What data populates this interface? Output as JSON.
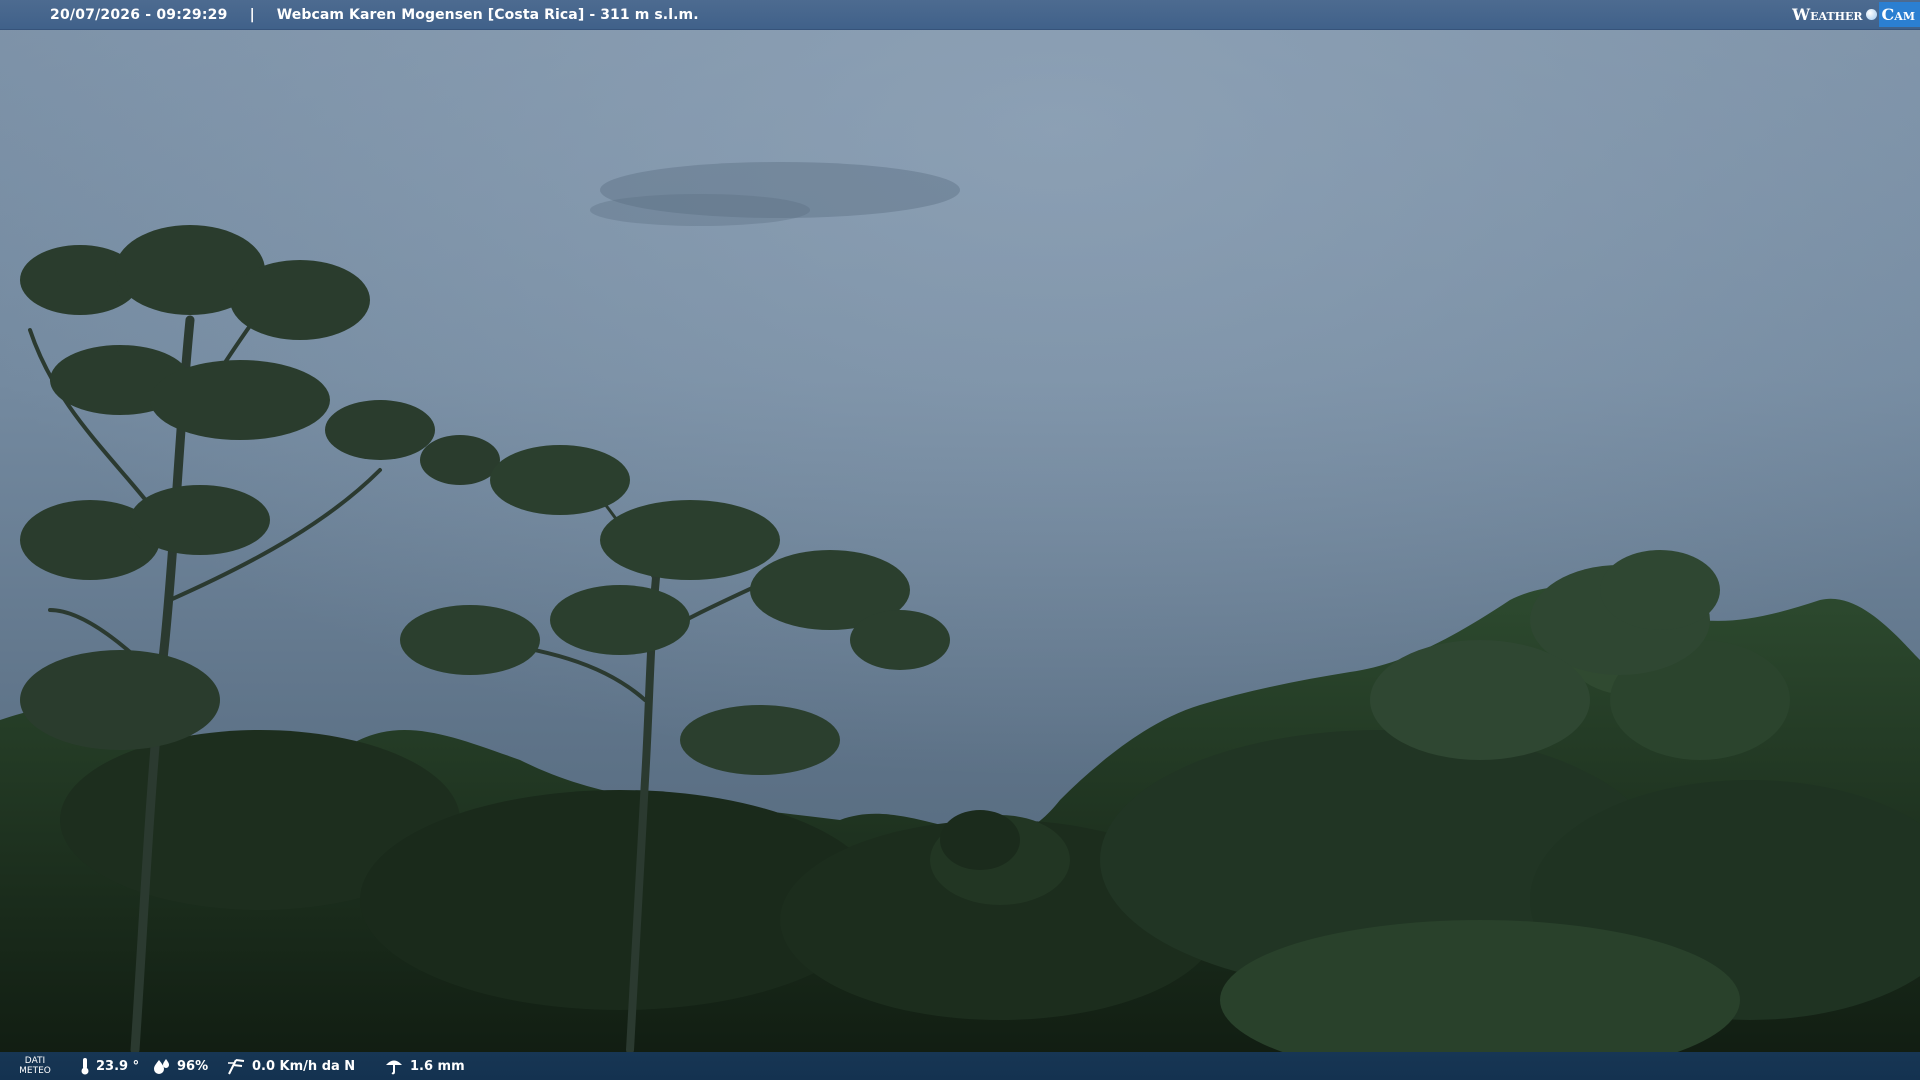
{
  "header": {
    "timestamp": "20/07/2026 - 09:29:29",
    "separator": "|",
    "title": "Webcam Karen Mogensen [Costa Rica]  - 311 m s.l.m.",
    "logo_left": "Weather",
    "logo_right": "Cam"
  },
  "footer": {
    "label": [
      "DATI",
      "METEO"
    ],
    "temperature": "23.9 °",
    "humidity": "96%",
    "wind": "0.0 Km/h da N",
    "rain": "1.6 mm",
    "icons": [
      "thermometer-icon",
      "humidity-icon",
      "wind-icon",
      "rain-gauge-icon"
    ]
  },
  "colors": {
    "topbar": "#46668d",
    "bottombar": "#163453",
    "sky": "#6f849a",
    "forest": "#18261a"
  }
}
